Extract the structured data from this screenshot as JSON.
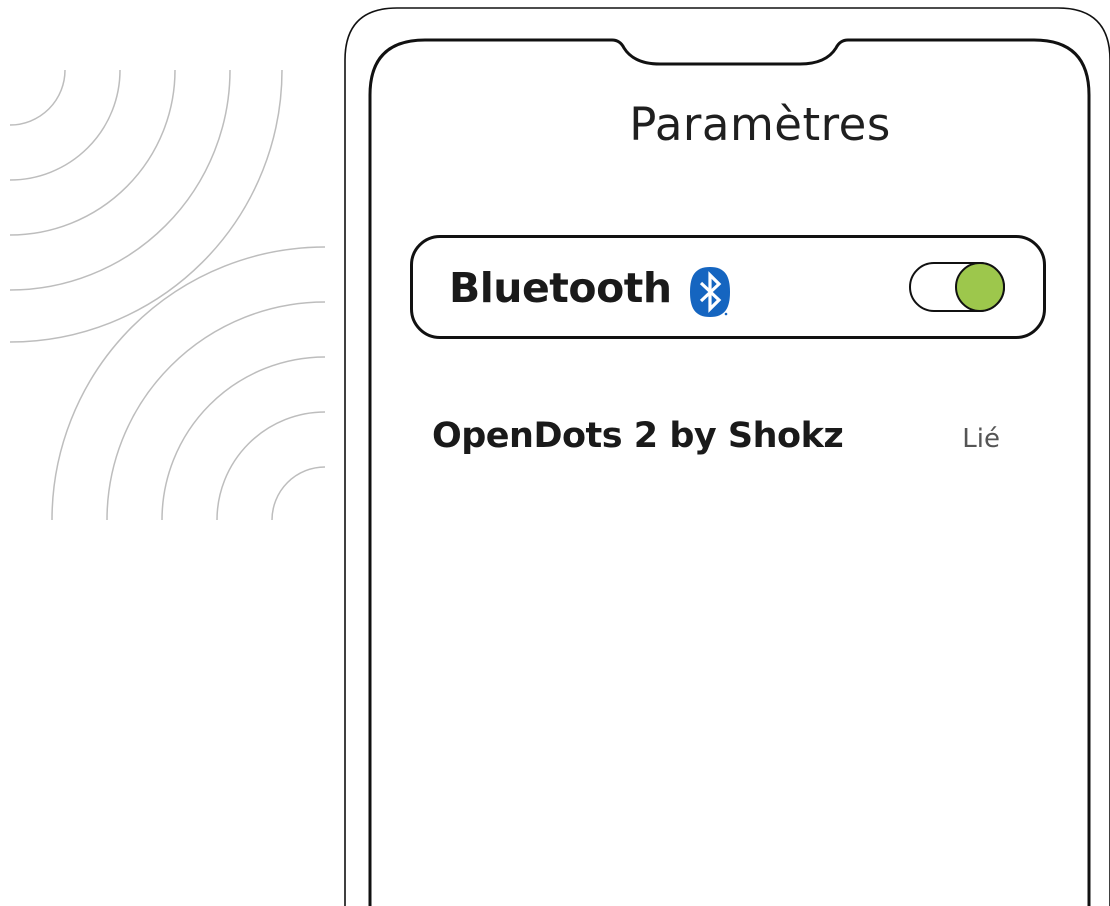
{
  "screen": {
    "title": "Paramètres"
  },
  "bluetooth": {
    "label": "Bluetooth",
    "icon": "bluetooth-icon",
    "icon_color": "#1565c0",
    "toggle_state": "on",
    "toggle_on_color": "#9dc74c"
  },
  "devices": [
    {
      "name": "OpenDots 2 by Shokz",
      "status": "Lié"
    }
  ],
  "colors": {
    "outline": "#111111",
    "waves": "#bdbdbd",
    "background": "#ffffff"
  }
}
